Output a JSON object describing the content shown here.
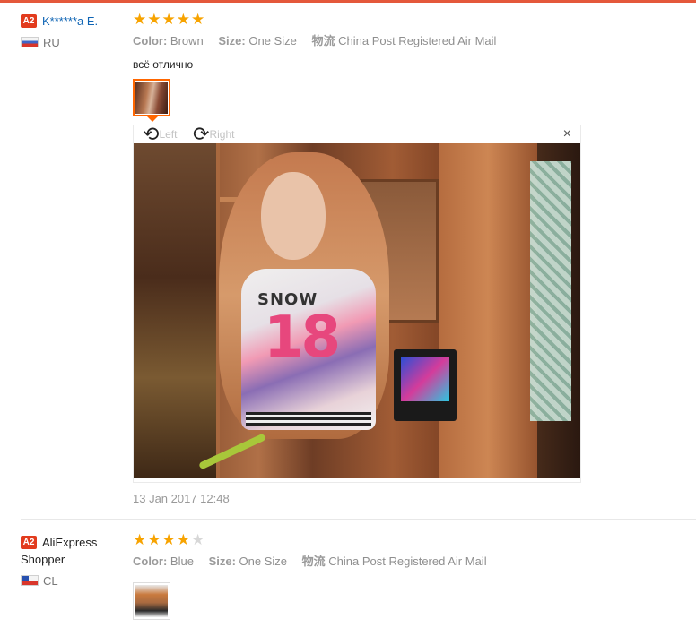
{
  "reviews": [
    {
      "badge": "A2",
      "username": "K******a E.",
      "country": "RU",
      "rating": 5,
      "attributes": {
        "color_label": "Color:",
        "color_value": "Brown",
        "size_label": "Size:",
        "size_value": "One Size",
        "shipping_label": "物流",
        "shipping_value": "China Post Registered Air Mail"
      },
      "text": "всё отлично",
      "viewer": {
        "rotate_left_label": "Left",
        "rotate_right_label": "Right",
        "close_glyph": "×",
        "photo_text_top": "SNOW",
        "photo_text_number": "18"
      },
      "date": "13 Jan 2017 12:48"
    },
    {
      "badge": "A2",
      "username": "AliExpress Shopper",
      "country": "CL",
      "rating": 4,
      "attributes": {
        "color_label": "Color:",
        "color_value": "Blue",
        "size_label": "Size:",
        "size_value": "One Size",
        "shipping_label": "物流",
        "shipping_value": "China Post Registered Air Mail"
      }
    }
  ],
  "icons": {
    "star": "★",
    "rotate_left": "⟲",
    "rotate_right": "⟳"
  },
  "colors": {
    "accent": "#e4583b",
    "badge": "#e23b1d",
    "star": "#f7a300",
    "star_empty": "#d7d7d7",
    "username_link": "#0e64b4",
    "thumb_active_border": "#ff6600"
  }
}
